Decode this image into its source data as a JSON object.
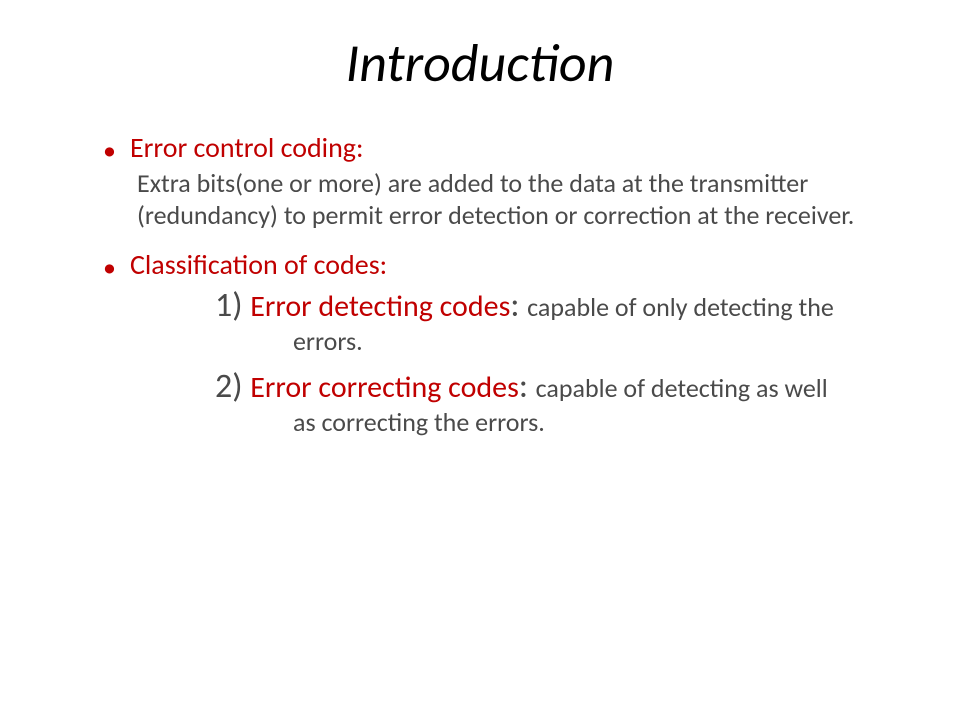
{
  "title": "Introduction",
  "bullet1": {
    "label": "Error control coding:",
    "body": "Extra bits(one or more) are added to the data at the transmitter (redundancy) to permit error detection or correction at the receiver."
  },
  "bullet2": {
    "label": "Classification of codes:",
    "item1": {
      "num": "1) ",
      "term": "Error detecting codes",
      "colon": ": ",
      "desc": "capable of only detecting the errors."
    },
    "item2": {
      "num": "2) ",
      "term": "Error correcting codes",
      "colon": ": ",
      "desc": "capable of detecting as well as correcting the errors."
    }
  }
}
